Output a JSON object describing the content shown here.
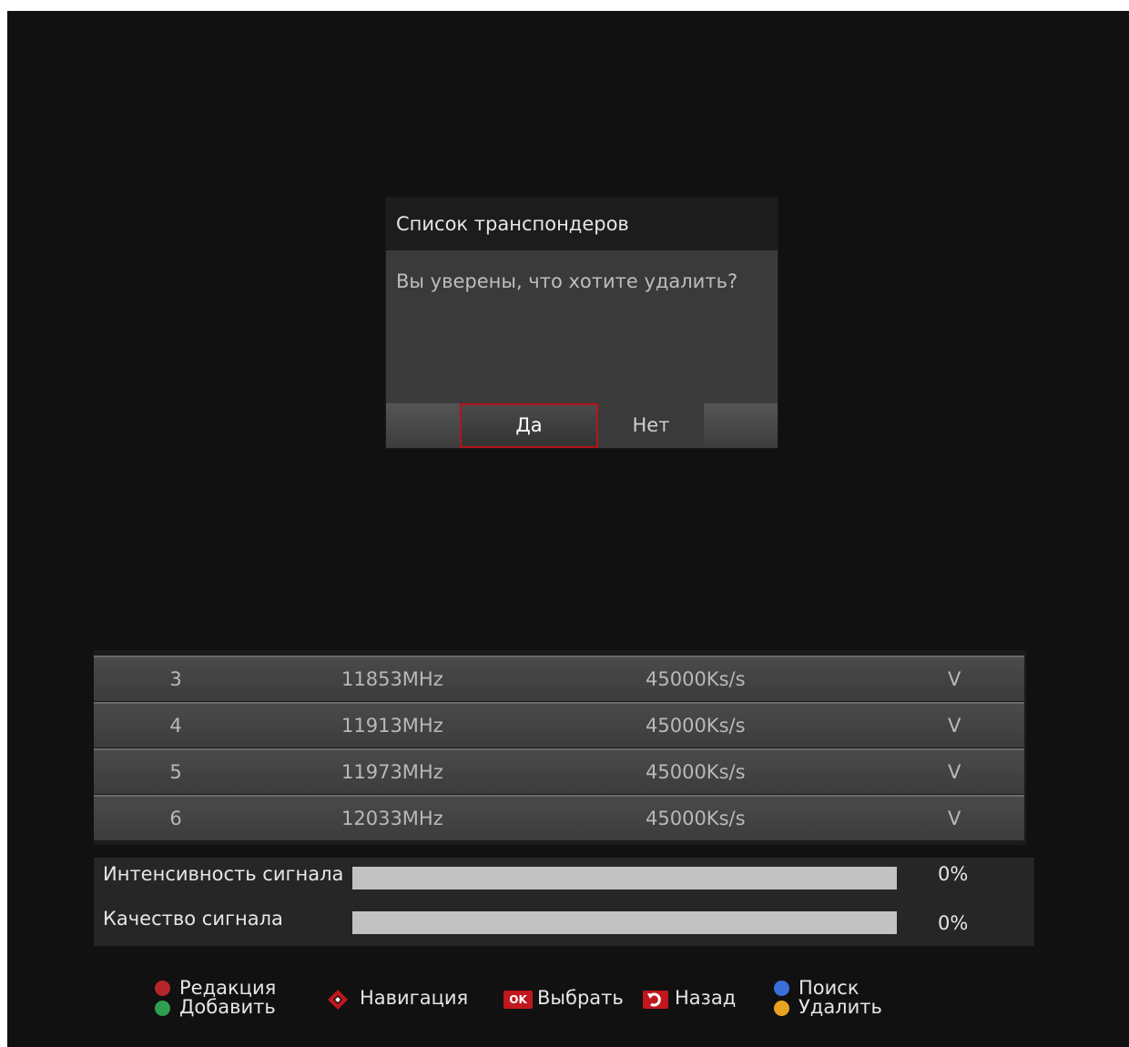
{
  "dialog": {
    "title": "Список транспондеров",
    "message": "Вы уверены, что хотите удалить?",
    "yes_label": "Да",
    "no_label": "Нет"
  },
  "transponders": [
    {
      "num": "3",
      "freq": "11853MHz",
      "symbol_rate": "45000Ks/s",
      "pol": "V"
    },
    {
      "num": "4",
      "freq": "11913MHz",
      "symbol_rate": "45000Ks/s",
      "pol": "V"
    },
    {
      "num": "5",
      "freq": "11973MHz",
      "symbol_rate": "45000Ks/s",
      "pol": "V"
    },
    {
      "num": "6",
      "freq": "12033MHz",
      "symbol_rate": "45000Ks/s",
      "pol": "V"
    }
  ],
  "signal": {
    "strength_label": "Интенсивность сигнала",
    "strength_value": "0%",
    "strength_fraction": 0,
    "quality_label": "Качество сигнала",
    "quality_value": "0%",
    "quality_fraction": 0
  },
  "legend": {
    "edit_label": "Редакция",
    "add_label": "Добавить",
    "nav_label": "Навигация",
    "ok_key": "OK",
    "select_label": "Выбрать",
    "back_label": "Назад",
    "search_label": "Поиск",
    "delete_label": "Удалить"
  },
  "colors": {
    "red": "#b3262a",
    "green": "#2e9e4f",
    "blue": "#3a6fd8",
    "yellow": "#e8a320",
    "focus_border": "#b3141b"
  },
  "icons": {
    "nav": "dpad-icon",
    "back": "return-arrow-icon"
  }
}
